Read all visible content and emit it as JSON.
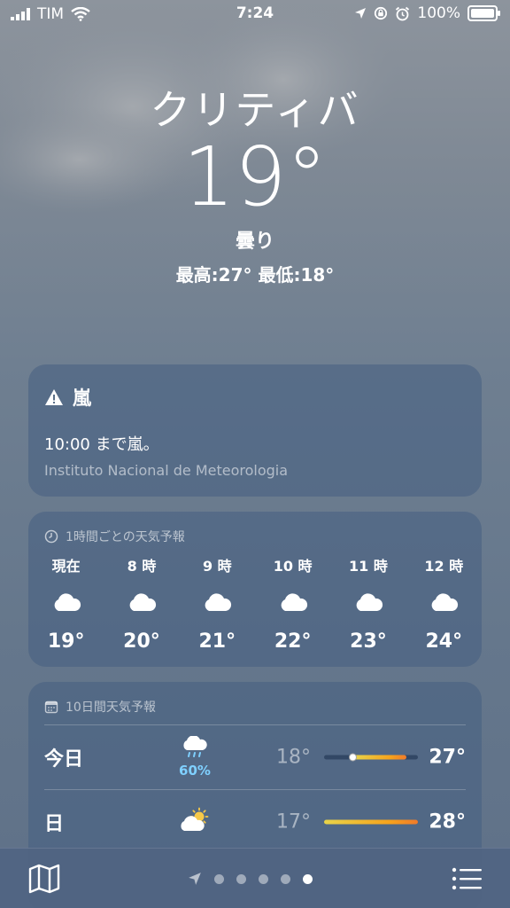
{
  "status_bar": {
    "carrier": "TIM",
    "time": "7:24",
    "battery": "100%",
    "battery_level": 1.0
  },
  "header": {
    "city": "クリティバ",
    "temperature": "19°",
    "condition": "曇り",
    "high_low": "最高:27°  最低:18°"
  },
  "alert": {
    "title": "嵐",
    "body": "10:00 まで嵐。",
    "source": "Instituto Nacional de Meteorologia"
  },
  "hourly": {
    "title": "1時間ごとの天気予報",
    "items": [
      {
        "label": "現在",
        "icon": "cloud-icon",
        "temp": "19°"
      },
      {
        "label": "8 時",
        "icon": "cloud-icon",
        "temp": "20°"
      },
      {
        "label": "9 時",
        "icon": "cloud-icon",
        "temp": "21°"
      },
      {
        "label": "10 時",
        "icon": "cloud-icon",
        "temp": "22°"
      },
      {
        "label": "11 時",
        "icon": "cloud-icon",
        "temp": "23°"
      },
      {
        "label": "12 時",
        "icon": "cloud-icon",
        "temp": "24°"
      }
    ]
  },
  "daily": {
    "title": "10日間天気予報",
    "days": [
      {
        "name": "今日",
        "icon": "cloud-rain-icon",
        "precip": "60%",
        "low": "18°",
        "high": "27°",
        "range_start": 0.32,
        "range_end": 0.88,
        "current": 0.3
      },
      {
        "name": "日",
        "icon": "sun-cloud-icon",
        "precip": "",
        "low": "17°",
        "high": "28°",
        "range_start": 0.0,
        "range_end": 1.0
      }
    ]
  },
  "bottom_bar": {
    "page_count": 5,
    "active_page": 5
  },
  "colors": {
    "precip": "#7fd0ff",
    "range_cool": "#e8d44a",
    "range_warm": "#f6a21b",
    "range_hot": "#f07a2a"
  }
}
